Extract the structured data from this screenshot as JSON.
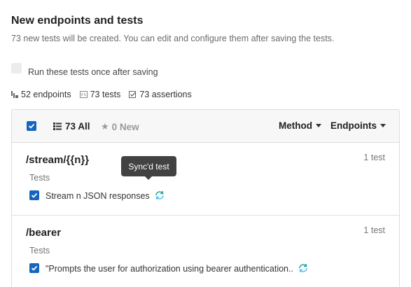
{
  "header": {
    "title": "New endpoints and tests",
    "subtitle": "73 new tests will be created. You can edit and configure them after saving the tests."
  },
  "run_option": {
    "label": "Run these tests once after saving",
    "checked": false
  },
  "stats": {
    "endpoints": "52 endpoints",
    "tests": "73 tests",
    "assertions": "73 assertions"
  },
  "panel": {
    "all_label": "73 All",
    "new_label": "0 New",
    "method_label": "Method",
    "endpoints_label": "Endpoints",
    "select_all_checked": true
  },
  "tooltip": "Sync'd test",
  "endpoints": [
    {
      "path": "/stream/{{n}}",
      "count": "1 test",
      "section": "Tests",
      "test_name": "Stream n JSON responses",
      "checked": true
    },
    {
      "path": "/bearer",
      "count": "1 test",
      "section": "Tests",
      "test_name": "\"Prompts the user for authorization using bearer authentication..",
      "checked": true
    }
  ],
  "colors": {
    "accent": "#1565c0",
    "sync": "#26a69a",
    "tooltip_bg": "#424242"
  }
}
